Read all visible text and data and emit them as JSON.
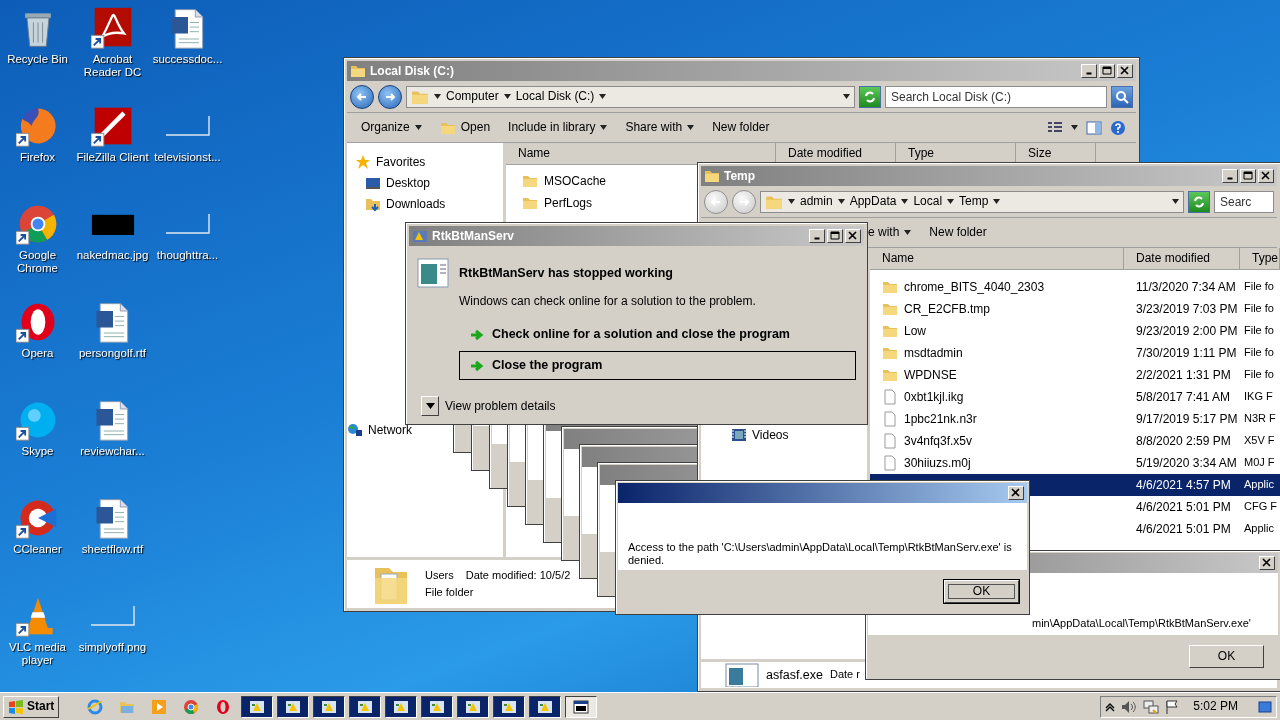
{
  "desktop_icons": [
    {
      "label": "Recycle Bin",
      "kind": "recycle",
      "shortcut": false
    },
    {
      "label": "Firefox",
      "kind": "firefox",
      "shortcut": true
    },
    {
      "label": "Google Chrome",
      "kind": "chrome",
      "shortcut": true
    },
    {
      "label": "Opera",
      "kind": "opera",
      "shortcut": true
    },
    {
      "label": "Skype",
      "kind": "skype",
      "shortcut": true
    },
    {
      "label": "CCleaner",
      "kind": "ccleaner",
      "shortcut": true
    },
    {
      "label": "VLC media player",
      "kind": "vlc",
      "shortcut": true
    },
    {
      "label": "Acrobat Reader DC",
      "kind": "acrobat",
      "shortcut": true
    },
    {
      "label": "FileZilla Client",
      "kind": "filezilla",
      "shortcut": true
    },
    {
      "label": "nakedmac.jpg",
      "kind": "dark-image",
      "shortcut": false
    },
    {
      "label": "persongolf.rtf",
      "kind": "document",
      "shortcut": false
    },
    {
      "label": "reviewchar...",
      "kind": "document",
      "shortcut": false
    },
    {
      "label": "sheetflow.rtf",
      "kind": "document",
      "shortcut": false
    },
    {
      "label": "simplyoff.png",
      "kind": "blank-image",
      "shortcut": false
    },
    {
      "label": "successdoc...",
      "kind": "document",
      "shortcut": false
    },
    {
      "label": "televisionst...",
      "kind": "blank-image",
      "shortcut": false
    },
    {
      "label": "thoughttra...",
      "kind": "blank-image",
      "shortcut": false
    }
  ],
  "explorer": {
    "title": "Local Disk (C:)",
    "nav_enabled": true,
    "breadcrumb": [
      "Computer",
      "Local Disk (C:)"
    ],
    "search": {
      "placeholder": "Search Local Disk (C:)"
    },
    "toolbar": [
      {
        "label": "Organize",
        "kind": "menu"
      },
      {
        "label": "Open",
        "kind": "open"
      },
      {
        "label": "Include in library",
        "kind": "menu"
      },
      {
        "label": "Share with",
        "kind": "menu"
      },
      {
        "label": "New folder",
        "kind": "plain"
      }
    ],
    "nav": [
      {
        "label": "Favorites",
        "kind": "star"
      },
      {
        "label": "Desktop",
        "kind": "desktop"
      },
      {
        "label": "Downloads",
        "kind": "downloads"
      },
      {
        "label": "Network",
        "kind": "network"
      }
    ],
    "columns": [
      "Name",
      "Date modified",
      "Type",
      "Size"
    ],
    "files": [
      {
        "name": "MSOCache",
        "kind": "folder"
      },
      {
        "name": "PerfLogs",
        "kind": "folder"
      }
    ],
    "details": {
      "name": "Users",
      "meta": "Date modified: 10/5/2",
      "type": "File folder"
    }
  },
  "temp": {
    "title": "Temp",
    "nav_enabled": false,
    "breadcrumb": [
      "admin",
      "AppData",
      "Local",
      "Temp"
    ],
    "search": {
      "placeholder": "Searc"
    },
    "toolbar": [
      {
        "label": "e with",
        "kind": "menu"
      },
      {
        "label": "New folder",
        "kind": "plain"
      }
    ],
    "nav": [
      {
        "label": "Videos",
        "kind": "videos"
      }
    ],
    "columns": [
      "Name",
      "Date modified",
      "Type"
    ],
    "rows": [
      {
        "name": "chrome_BITS_4040_2303",
        "kind": "folder",
        "date": "11/3/2020 7:34 AM",
        "type": "File fo",
        "selected": false
      },
      {
        "name": "CR_E2CFB.tmp",
        "kind": "folder",
        "date": "3/23/2019 7:03 PM",
        "type": "File fo",
        "selected": false
      },
      {
        "name": "Low",
        "kind": "folder",
        "date": "9/23/2019 2:00 PM",
        "type": "File fo",
        "selected": false
      },
      {
        "name": "msdtadmin",
        "kind": "folder",
        "date": "7/30/2019 1:11 PM",
        "type": "File fo",
        "selected": false
      },
      {
        "name": "WPDNSE",
        "kind": "folder",
        "date": "2/2/2021 1:31 PM",
        "type": "File fo",
        "selected": false
      },
      {
        "name": "0xbt1kjl.ikg",
        "kind": "file",
        "date": "5/8/2017 7:41 AM",
        "type": "IKG F",
        "selected": false
      },
      {
        "name": "1pbc21nk.n3r",
        "kind": "file",
        "date": "9/17/2019 5:17 PM",
        "type": "N3R F",
        "selected": false
      },
      {
        "name": "3v4nfq3f.x5v",
        "kind": "file",
        "date": "8/8/2020 2:59 PM",
        "type": "X5V F",
        "selected": false
      },
      {
        "name": "30hiiuzs.m0j",
        "kind": "file",
        "date": "5/19/2020 3:34 AM",
        "type": "M0J F",
        "selected": false
      },
      {
        "date": "4/6/2021 4:57 PM",
        "type": "Applic",
        "selected": true
      },
      {
        "date": "4/6/2021 5:01 PM",
        "type": "CFG F",
        "selected": false
      },
      {
        "date": "4/6/2021 5:01 PM",
        "type": "Applic",
        "selected": false
      }
    ],
    "details": {
      "name": "asfasf.exe",
      "meta": "Date r"
    }
  },
  "crash_dialog": {
    "title": "RtkBtManServ",
    "heading": "RtkBtManServ has stopped working",
    "message": "Windows can check online for a solution to the problem.",
    "options": [
      {
        "label": "Check online for a solution and close the program",
        "selected": false
      },
      {
        "label": "Close the program",
        "selected": true
      }
    ],
    "details_toggle": "View problem details"
  },
  "error_dialog": {
    "message": "Access to the path 'C:\\Users\\admin\\AppData\\Local\\Temp\\RtkBtManServ.exe' is denied.",
    "button": "OK",
    "active": true
  },
  "error_dialog_behind": {
    "message": "min\\AppData\\Local\\Temp\\RtkBtManServ.exe'",
    "button": "OK",
    "active": false
  },
  "taskbar": {
    "start": "Start",
    "quick_launch": [
      {
        "kind": "ie"
      },
      {
        "kind": "explorer"
      },
      {
        "kind": "media"
      },
      {
        "kind": "chrome"
      },
      {
        "kind": "opera"
      }
    ],
    "tasks": [
      {
        "kind": "app"
      },
      {
        "kind": "app"
      },
      {
        "kind": "app"
      },
      {
        "kind": "app"
      },
      {
        "kind": "app"
      },
      {
        "kind": "app"
      },
      {
        "kind": "app"
      },
      {
        "kind": "app"
      },
      {
        "kind": "app"
      },
      {
        "kind": "console"
      }
    ],
    "clock": "5:02 PM"
  }
}
